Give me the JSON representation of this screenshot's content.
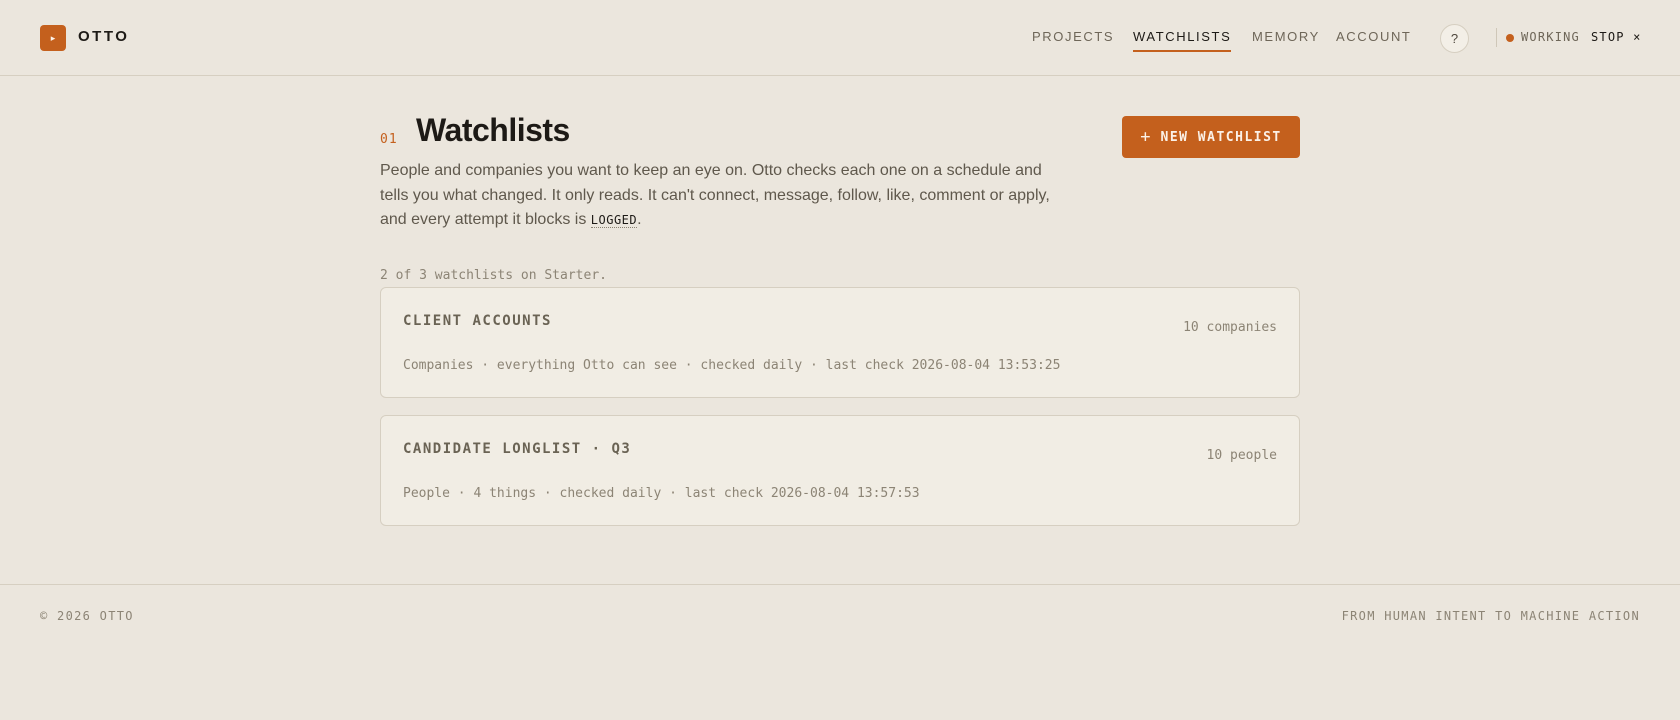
{
  "brand": {
    "name": "OTTO",
    "logo_glyph": "▸",
    "accent": "#c4601d"
  },
  "nav": {
    "items": [
      {
        "label": "PROJECTS",
        "active": false
      },
      {
        "label": "WATCHLISTS",
        "active": true
      },
      {
        "label": "MEMORY",
        "active": false
      },
      {
        "label": "ACCOUNT",
        "active": false
      }
    ],
    "help_label": "?",
    "status_label": "WORKING",
    "stop_label": "STOP ×"
  },
  "page": {
    "section_number": "01",
    "title": "Watchlists",
    "description_before": "People and companies you want to keep an eye on. Otto checks each one on a schedule and tells you what changed. It only reads. It can't connect, message, follow, like, comment or apply, and every attempt it blocks is ",
    "description_code": "LOGGED",
    "description_after": ".",
    "new_button_icon": "+",
    "new_button_label": "NEW WATCHLIST",
    "quota_text": "2 of 3 watchlists on Starter."
  },
  "watchlists": [
    {
      "name": "CLIENT ACCOUNTS",
      "count": "10 companies",
      "meta": "Companies · everything Otto can see · checked daily · last check 2026-08-04 13:53:25"
    },
    {
      "name": "CANDIDATE LONGLIST · Q3",
      "count": "10 people",
      "meta": "People · 4 things · checked daily · last check 2026-08-04 13:57:53"
    }
  ],
  "footer": {
    "copyright": "© 2026 OTTO",
    "tagline": "FROM HUMAN INTENT TO MACHINE ACTION"
  }
}
